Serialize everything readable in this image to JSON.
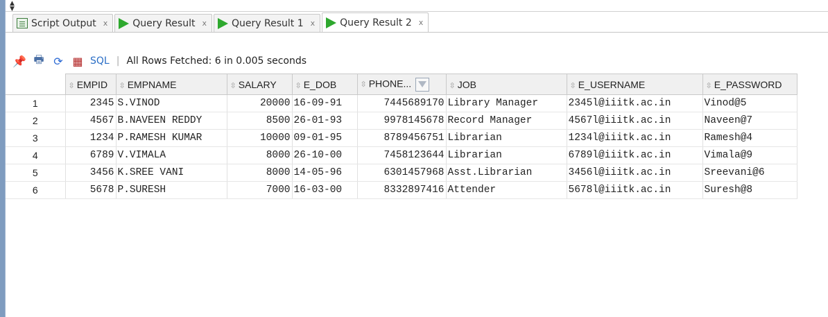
{
  "tabs": [
    {
      "label": "Script Output",
      "icon": "script-icon",
      "close": "x"
    },
    {
      "label": "Query Result",
      "icon": "play-icon",
      "close": "x"
    },
    {
      "label": "Query Result 1",
      "icon": "play-icon",
      "close": "x"
    },
    {
      "label": "Query Result 2",
      "icon": "play-icon",
      "close": "x"
    }
  ],
  "toolbar": {
    "sql_label": "SQL",
    "separator": "|",
    "status": "All Rows Fetched: 6 in 0.005 seconds"
  },
  "colors": {
    "accent_green": "#2ea82e",
    "link_blue": "#2a6ec6"
  },
  "grid": {
    "columns": [
      "EMPID",
      "EMPNAME",
      "SALARY",
      "E_DOB",
      "PHONE...",
      "JOB",
      "E_USERNAME",
      "E_PASSWORD"
    ],
    "rows": [
      {
        "n": "1",
        "empid": "2345",
        "empname": "S.VINOD",
        "salary": "20000",
        "dob": "16-09-91",
        "phone": "7445689170",
        "job": "Library Manager",
        "username": "2345l@iiitk.ac.in",
        "password": "Vinod@5"
      },
      {
        "n": "2",
        "empid": "4567",
        "empname": "B.NAVEEN REDDY",
        "salary": "8500",
        "dob": "26-01-93",
        "phone": "9978145678",
        "job": "Record Manager",
        "username": "4567l@iiitk.ac.in",
        "password": "Naveen@7"
      },
      {
        "n": "3",
        "empid": "1234",
        "empname": "P.RAMESH KUMAR",
        "salary": "10000",
        "dob": "09-01-95",
        "phone": "8789456751",
        "job": "Librarian",
        "username": "1234l@iiitk.ac.in",
        "password": "Ramesh@4"
      },
      {
        "n": "4",
        "empid": "6789",
        "empname": "V.VIMALA",
        "salary": "8000",
        "dob": "26-10-00",
        "phone": "7458123644",
        "job": "Librarian",
        "username": "6789l@iiitk.ac.in",
        "password": "Vimala@9"
      },
      {
        "n": "5",
        "empid": "3456",
        "empname": "K.SREE VANI",
        "salary": "8000",
        "dob": "14-05-96",
        "phone": "6301457968",
        "job": "Asst.Librarian",
        "username": "3456l@iiitk.ac.in",
        "password": "Sreevani@6"
      },
      {
        "n": "6",
        "empid": "5678",
        "empname": "P.SURESH",
        "salary": "7000",
        "dob": "16-03-00",
        "phone": "8332897416",
        "job": "Attender",
        "username": "5678l@iiitk.ac.in",
        "password": "Suresh@8"
      }
    ]
  }
}
